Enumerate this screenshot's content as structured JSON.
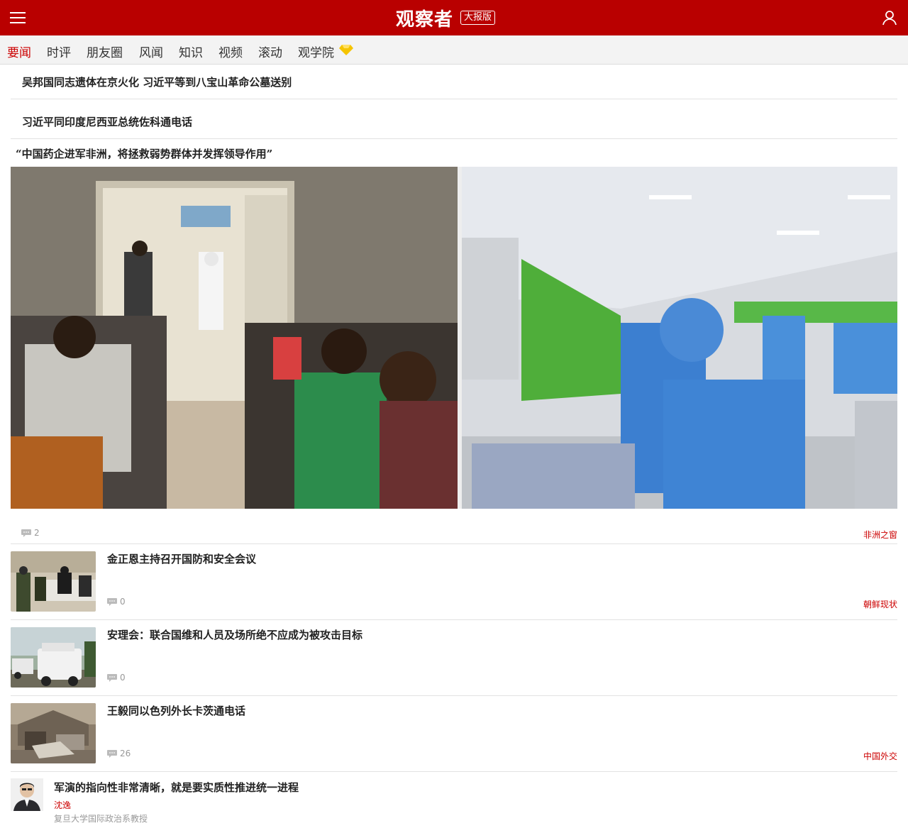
{
  "header": {
    "logo": "观察者",
    "badge": "大报版"
  },
  "nav": {
    "items": [
      "要闻",
      "时评",
      "朋友圈",
      "风闻",
      "知识",
      "视频",
      "滚动",
      "观学院"
    ],
    "active": "要闻"
  },
  "headlines": [
    "吴邦国同志遗体在京火化 习近平等到八宝山革命公墓送别",
    "习近平同印度尼西亚总统佐科通电话"
  ],
  "feature": {
    "title": "“中国药企进军非洲，将拯救弱势群体并发挥领导作用”",
    "comments": "2",
    "tag": "非洲之窗"
  },
  "news": [
    {
      "title": "金正恩主持召开国防和安全会议",
      "comments": "0",
      "tag": "朝鲜现状"
    },
    {
      "title": "安理会：联合国维和人员及场所绝不应成为被攻击目标",
      "comments": "0",
      "tag": ""
    },
    {
      "title": "王毅同以色列外长卡茨通电话",
      "comments": "26",
      "tag": "中国外交"
    }
  ],
  "opinion": {
    "title": "军演的指向性非常清晰，就是要实质性推进统一进程",
    "author": "沈逸",
    "role": "复旦大学国际政治系教授"
  },
  "colors": {
    "brand": "#b90000",
    "tag": "#cc0000",
    "gem": "#f5c400"
  }
}
